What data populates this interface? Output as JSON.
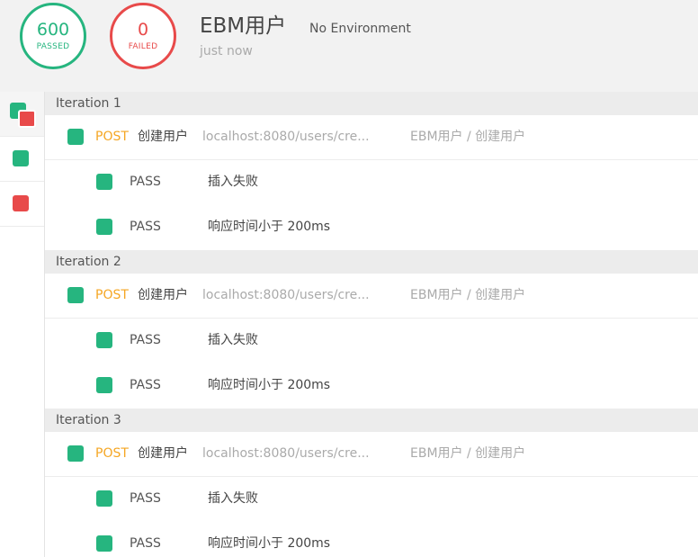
{
  "summary": {
    "passed_count": "600",
    "passed_label": "PASSED",
    "failed_count": "0",
    "failed_label": "FAILED",
    "collection_name": "EBM用户",
    "environment": "No Environment",
    "run_time": "just now"
  },
  "colors": {
    "pass": "#26b57f",
    "fail": "#e84a4a",
    "method_post": "#f5a623"
  },
  "filters": [
    {
      "id": "all",
      "icon": "pass-fail-squares-icon"
    },
    {
      "id": "passed",
      "icon": "green-square-icon"
    },
    {
      "id": "failed",
      "icon": "red-square-icon"
    }
  ],
  "iterations": [
    {
      "title": "Iteration 1",
      "request": {
        "method": "POST",
        "name": "创建用户",
        "url": "localhost:8080/users/cre...",
        "path": "EBM用户 / 创建用户"
      },
      "tests": [
        {
          "status": "PASS",
          "name": "插入失败"
        },
        {
          "status": "PASS",
          "name": "响应时间小于 200ms"
        }
      ]
    },
    {
      "title": "Iteration 2",
      "request": {
        "method": "POST",
        "name": "创建用户",
        "url": "localhost:8080/users/cre...",
        "path": "EBM用户 / 创建用户"
      },
      "tests": [
        {
          "status": "PASS",
          "name": "插入失败"
        },
        {
          "status": "PASS",
          "name": "响应时间小于 200ms"
        }
      ]
    },
    {
      "title": "Iteration 3",
      "request": {
        "method": "POST",
        "name": "创建用户",
        "url": "localhost:8080/users/cre...",
        "path": "EBM用户 / 创建用户"
      },
      "tests": [
        {
          "status": "PASS",
          "name": "插入失败"
        },
        {
          "status": "PASS",
          "name": "响应时间小于 200ms"
        }
      ]
    }
  ]
}
